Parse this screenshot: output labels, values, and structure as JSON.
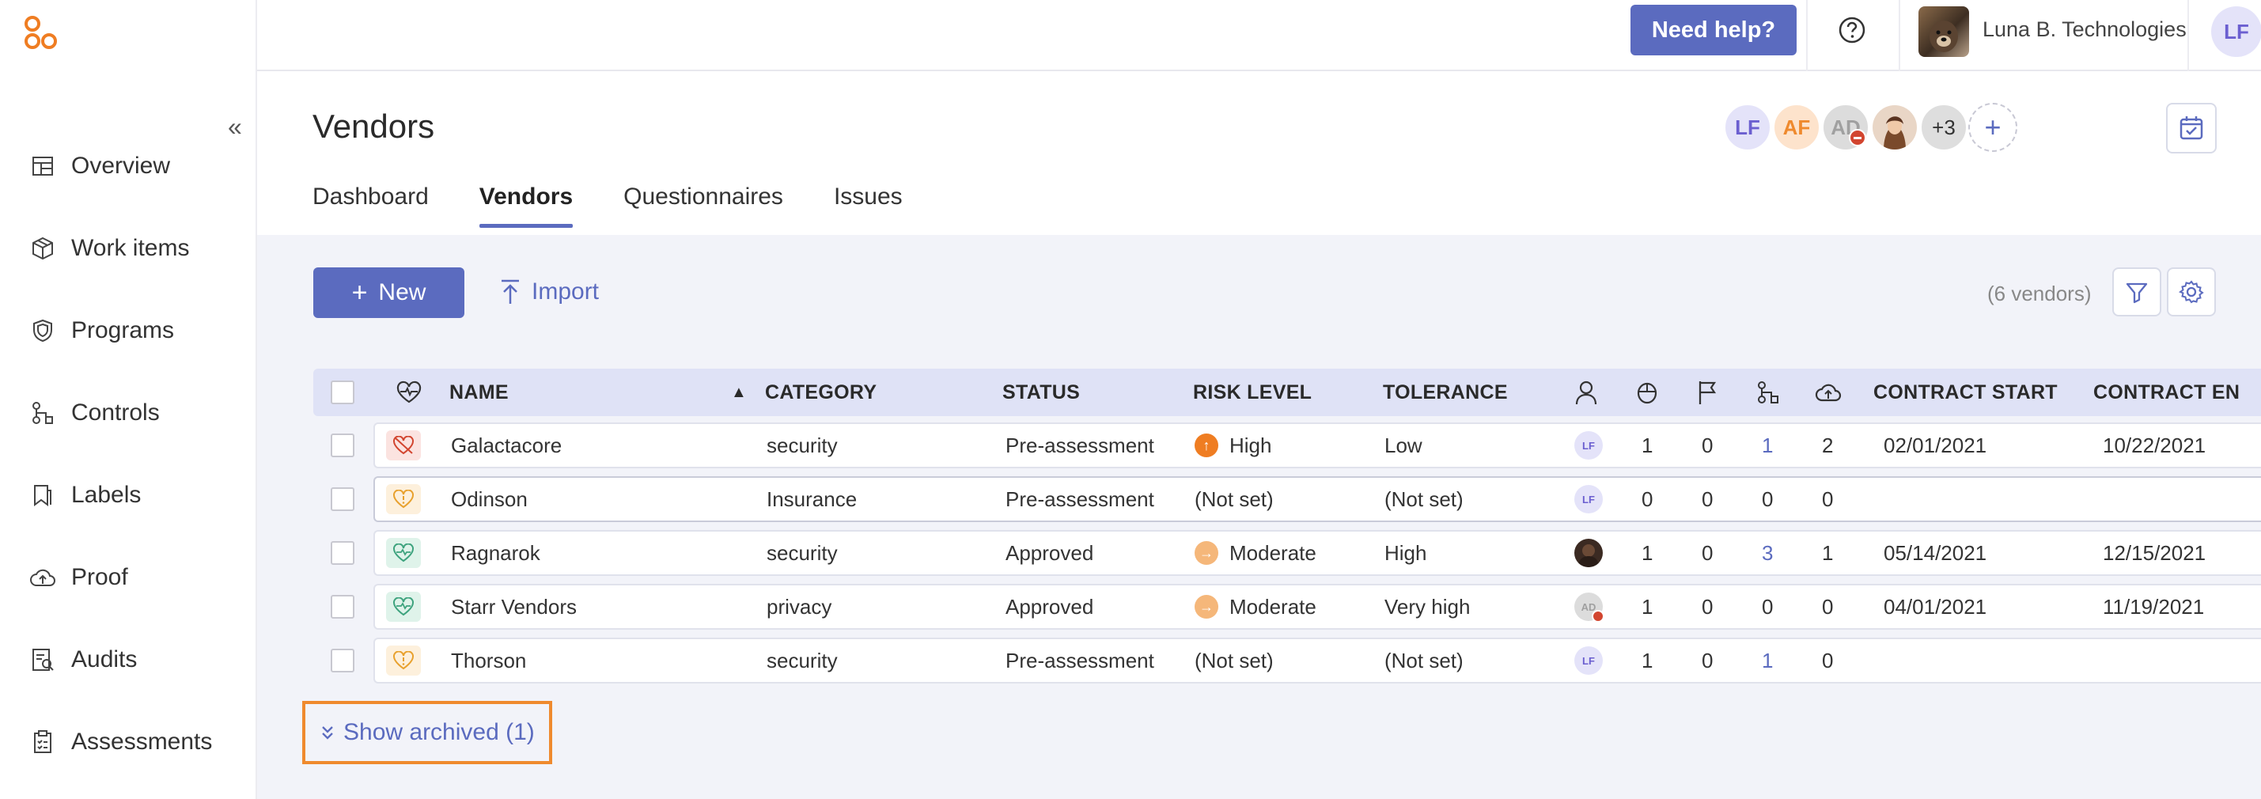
{
  "sidebar": {
    "items": [
      {
        "label": "Overview",
        "icon": "dashboard-icon"
      },
      {
        "label": "Work items",
        "icon": "box-icon"
      },
      {
        "label": "Programs",
        "icon": "shield-icon"
      },
      {
        "label": "Controls",
        "icon": "flow-icon"
      },
      {
        "label": "Labels",
        "icon": "tag-icon"
      },
      {
        "label": "Proof",
        "icon": "cloud-icon"
      },
      {
        "label": "Audits",
        "icon": "audit-icon"
      },
      {
        "label": "Assessments",
        "icon": "clipboard-icon"
      }
    ]
  },
  "topbar": {
    "help_label": "Need help?",
    "org_name": "Luna B. Technologies",
    "user_initials": "LF"
  },
  "header": {
    "title": "Vendors",
    "tabs": [
      "Dashboard",
      "Vendors",
      "Questionnaires",
      "Issues"
    ],
    "active_tab": "Vendors",
    "collaborators": [
      {
        "initials": "LF",
        "bg": "#e4e3f9",
        "fg": "#6b5fd0"
      },
      {
        "initials": "AF",
        "bg": "#fde3cc",
        "fg": "#ef8a2e"
      },
      {
        "initials": "AD",
        "bg": "#dcdcdc",
        "fg": "#a0a0a0"
      }
    ],
    "more_count": "+3"
  },
  "toolbar": {
    "new_label": "New",
    "import_label": "Import",
    "vendor_count": "(6 vendors)"
  },
  "table": {
    "columns": {
      "name": "NAME",
      "category": "CATEGORY",
      "status": "STATUS",
      "risk": "RISK LEVEL",
      "tolerance": "TOLERANCE",
      "contract_start": "CONTRACT START",
      "contract_end": "CONTRACT EN"
    },
    "rows": [
      {
        "health": "broken",
        "name": "Galactacore",
        "category": "security",
        "status": "Pre-assessment",
        "risk": "High",
        "risk_color": "#ef7d22",
        "risk_sym": "↑",
        "tolerance": "Low",
        "owner": "LF",
        "c1": "1",
        "c2": "0",
        "c3": "1",
        "c3_link": true,
        "c4": "2",
        "start": "02/01/2021",
        "end": "10/22/2021"
      },
      {
        "health": "unknown",
        "name": "Odinson",
        "category": "Insurance",
        "status": "Pre-assessment",
        "risk": "(Not set)",
        "risk_color": "",
        "risk_sym": "",
        "tolerance": "(Not set)",
        "owner": "LF",
        "c1": "0",
        "c2": "0",
        "c3": "0",
        "c3_link": false,
        "c4": "0",
        "start": "",
        "end": ""
      },
      {
        "health": "good",
        "name": "Ragnarok",
        "category": "security",
        "status": "Approved",
        "risk": "Moderate",
        "risk_color": "#f5b77a",
        "risk_sym": "→",
        "tolerance": "High",
        "owner": "photo",
        "c1": "1",
        "c2": "0",
        "c3": "3",
        "c3_link": true,
        "c4": "1",
        "start": "05/14/2021",
        "end": "12/15/2021"
      },
      {
        "health": "good",
        "name": "Starr Vendors",
        "category": "privacy",
        "status": "Approved",
        "risk": "Moderate",
        "risk_color": "#f5b77a",
        "risk_sym": "→",
        "tolerance": "Very high",
        "owner": "AD",
        "c1": "1",
        "c2": "0",
        "c3": "0",
        "c3_link": false,
        "c4": "0",
        "start": "04/01/2021",
        "end": "11/19/2021"
      },
      {
        "health": "unknown",
        "name": "Thorson",
        "category": "security",
        "status": "Pre-assessment",
        "risk": "(Not set)",
        "risk_color": "",
        "risk_sym": "",
        "tolerance": "(Not set)",
        "owner": "LF",
        "c1": "1",
        "c2": "0",
        "c3": "1",
        "c3_link": true,
        "c4": "0",
        "start": "",
        "end": ""
      }
    ]
  },
  "show_archived_label": "Show archived (1)",
  "colors": {
    "accent": "#5b6bbf",
    "highlight": "#ef8a2e"
  }
}
